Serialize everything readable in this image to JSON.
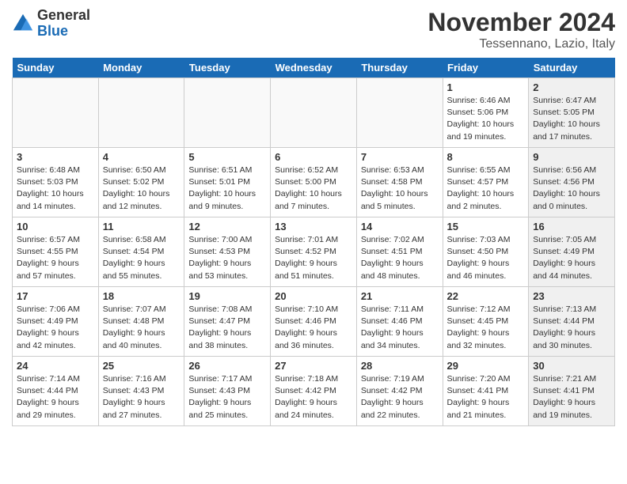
{
  "header": {
    "logo_general": "General",
    "logo_blue": "Blue",
    "title": "November 2024",
    "subtitle": "Tessennano, Lazio, Italy"
  },
  "weekdays": [
    "Sunday",
    "Monday",
    "Tuesday",
    "Wednesday",
    "Thursday",
    "Friday",
    "Saturday"
  ],
  "weeks": [
    [
      {
        "day": "",
        "info": "",
        "shaded": false
      },
      {
        "day": "",
        "info": "",
        "shaded": false
      },
      {
        "day": "",
        "info": "",
        "shaded": false
      },
      {
        "day": "",
        "info": "",
        "shaded": false
      },
      {
        "day": "",
        "info": "",
        "shaded": false
      },
      {
        "day": "1",
        "info": "Sunrise: 6:46 AM\nSunset: 5:06 PM\nDaylight: 10 hours and 19 minutes.",
        "shaded": false
      },
      {
        "day": "2",
        "info": "Sunrise: 6:47 AM\nSunset: 5:05 PM\nDaylight: 10 hours and 17 minutes.",
        "shaded": true
      }
    ],
    [
      {
        "day": "3",
        "info": "Sunrise: 6:48 AM\nSunset: 5:03 PM\nDaylight: 10 hours and 14 minutes.",
        "shaded": false
      },
      {
        "day": "4",
        "info": "Sunrise: 6:50 AM\nSunset: 5:02 PM\nDaylight: 10 hours and 12 minutes.",
        "shaded": false
      },
      {
        "day": "5",
        "info": "Sunrise: 6:51 AM\nSunset: 5:01 PM\nDaylight: 10 hours and 9 minutes.",
        "shaded": false
      },
      {
        "day": "6",
        "info": "Sunrise: 6:52 AM\nSunset: 5:00 PM\nDaylight: 10 hours and 7 minutes.",
        "shaded": false
      },
      {
        "day": "7",
        "info": "Sunrise: 6:53 AM\nSunset: 4:58 PM\nDaylight: 10 hours and 5 minutes.",
        "shaded": false
      },
      {
        "day": "8",
        "info": "Sunrise: 6:55 AM\nSunset: 4:57 PM\nDaylight: 10 hours and 2 minutes.",
        "shaded": false
      },
      {
        "day": "9",
        "info": "Sunrise: 6:56 AM\nSunset: 4:56 PM\nDaylight: 10 hours and 0 minutes.",
        "shaded": true
      }
    ],
    [
      {
        "day": "10",
        "info": "Sunrise: 6:57 AM\nSunset: 4:55 PM\nDaylight: 9 hours and 57 minutes.",
        "shaded": false
      },
      {
        "day": "11",
        "info": "Sunrise: 6:58 AM\nSunset: 4:54 PM\nDaylight: 9 hours and 55 minutes.",
        "shaded": false
      },
      {
        "day": "12",
        "info": "Sunrise: 7:00 AM\nSunset: 4:53 PM\nDaylight: 9 hours and 53 minutes.",
        "shaded": false
      },
      {
        "day": "13",
        "info": "Sunrise: 7:01 AM\nSunset: 4:52 PM\nDaylight: 9 hours and 51 minutes.",
        "shaded": false
      },
      {
        "day": "14",
        "info": "Sunrise: 7:02 AM\nSunset: 4:51 PM\nDaylight: 9 hours and 48 minutes.",
        "shaded": false
      },
      {
        "day": "15",
        "info": "Sunrise: 7:03 AM\nSunset: 4:50 PM\nDaylight: 9 hours and 46 minutes.",
        "shaded": false
      },
      {
        "day": "16",
        "info": "Sunrise: 7:05 AM\nSunset: 4:49 PM\nDaylight: 9 hours and 44 minutes.",
        "shaded": true
      }
    ],
    [
      {
        "day": "17",
        "info": "Sunrise: 7:06 AM\nSunset: 4:49 PM\nDaylight: 9 hours and 42 minutes.",
        "shaded": false
      },
      {
        "day": "18",
        "info": "Sunrise: 7:07 AM\nSunset: 4:48 PM\nDaylight: 9 hours and 40 minutes.",
        "shaded": false
      },
      {
        "day": "19",
        "info": "Sunrise: 7:08 AM\nSunset: 4:47 PM\nDaylight: 9 hours and 38 minutes.",
        "shaded": false
      },
      {
        "day": "20",
        "info": "Sunrise: 7:10 AM\nSunset: 4:46 PM\nDaylight: 9 hours and 36 minutes.",
        "shaded": false
      },
      {
        "day": "21",
        "info": "Sunrise: 7:11 AM\nSunset: 4:46 PM\nDaylight: 9 hours and 34 minutes.",
        "shaded": false
      },
      {
        "day": "22",
        "info": "Sunrise: 7:12 AM\nSunset: 4:45 PM\nDaylight: 9 hours and 32 minutes.",
        "shaded": false
      },
      {
        "day": "23",
        "info": "Sunrise: 7:13 AM\nSunset: 4:44 PM\nDaylight: 9 hours and 30 minutes.",
        "shaded": true
      }
    ],
    [
      {
        "day": "24",
        "info": "Sunrise: 7:14 AM\nSunset: 4:44 PM\nDaylight: 9 hours and 29 minutes.",
        "shaded": false
      },
      {
        "day": "25",
        "info": "Sunrise: 7:16 AM\nSunset: 4:43 PM\nDaylight: 9 hours and 27 minutes.",
        "shaded": false
      },
      {
        "day": "26",
        "info": "Sunrise: 7:17 AM\nSunset: 4:43 PM\nDaylight: 9 hours and 25 minutes.",
        "shaded": false
      },
      {
        "day": "27",
        "info": "Sunrise: 7:18 AM\nSunset: 4:42 PM\nDaylight: 9 hours and 24 minutes.",
        "shaded": false
      },
      {
        "day": "28",
        "info": "Sunrise: 7:19 AM\nSunset: 4:42 PM\nDaylight: 9 hours and 22 minutes.",
        "shaded": false
      },
      {
        "day": "29",
        "info": "Sunrise: 7:20 AM\nSunset: 4:41 PM\nDaylight: 9 hours and 21 minutes.",
        "shaded": false
      },
      {
        "day": "30",
        "info": "Sunrise: 7:21 AM\nSunset: 4:41 PM\nDaylight: 9 hours and 19 minutes.",
        "shaded": true
      }
    ]
  ]
}
